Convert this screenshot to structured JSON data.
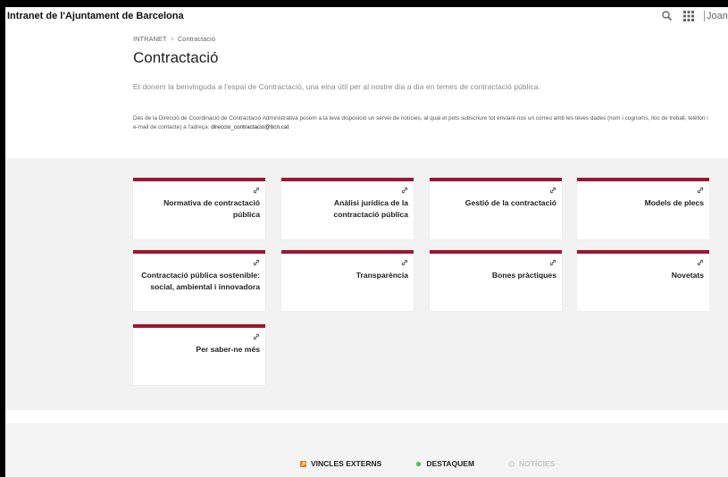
{
  "header": {
    "app_title": "Intranet de l'Ajuntament de Barcelona",
    "user_name": "Joana"
  },
  "breadcrumb": {
    "items": [
      "INTRANET",
      "Contractació"
    ],
    "separator": ">"
  },
  "page": {
    "title": "Contractació",
    "intro": "Et donem la benvinguda a l'espai de Contractació, una eina útil per al nostre dia a dia en temes de contractació pública.",
    "description": "Des de la Direcció de Coordinació de Contractació Administrativa posem a la teva disposició un servei de notícies, al qual et pots subscriure tot enviant-nos un correu amb les teves dades (nom i cognoms, lloc de treball, telèfon i e-mail de contacte) a l'adreça:",
    "email": "direccio_contractacio@bcn.cat"
  },
  "cards": [
    "Normativa de contractació pública",
    "Anàlisi jurídica de la contractació pública",
    "Gestió de la contractació",
    "Models de plecs",
    "Contractació pública sostenible: social, ambiental i innovadora",
    "Transparència",
    "Bones pràctiques",
    "Novetats",
    "Per saber-ne més"
  ],
  "footer_tabs": [
    {
      "label": "VINCLES EXTERNS",
      "icon": "external-links-icon",
      "color": "#e8811a",
      "active": true
    },
    {
      "label": "DESTAQUEM",
      "icon": "highlight-icon",
      "color": "#5cb85c",
      "active": true
    },
    {
      "label": "NOTÍCIES",
      "icon": "news-icon",
      "color": "#c8c8c8",
      "active": false
    }
  ],
  "colors": {
    "accent": "#9b1631",
    "grey_bg": "#f2f2f2"
  }
}
